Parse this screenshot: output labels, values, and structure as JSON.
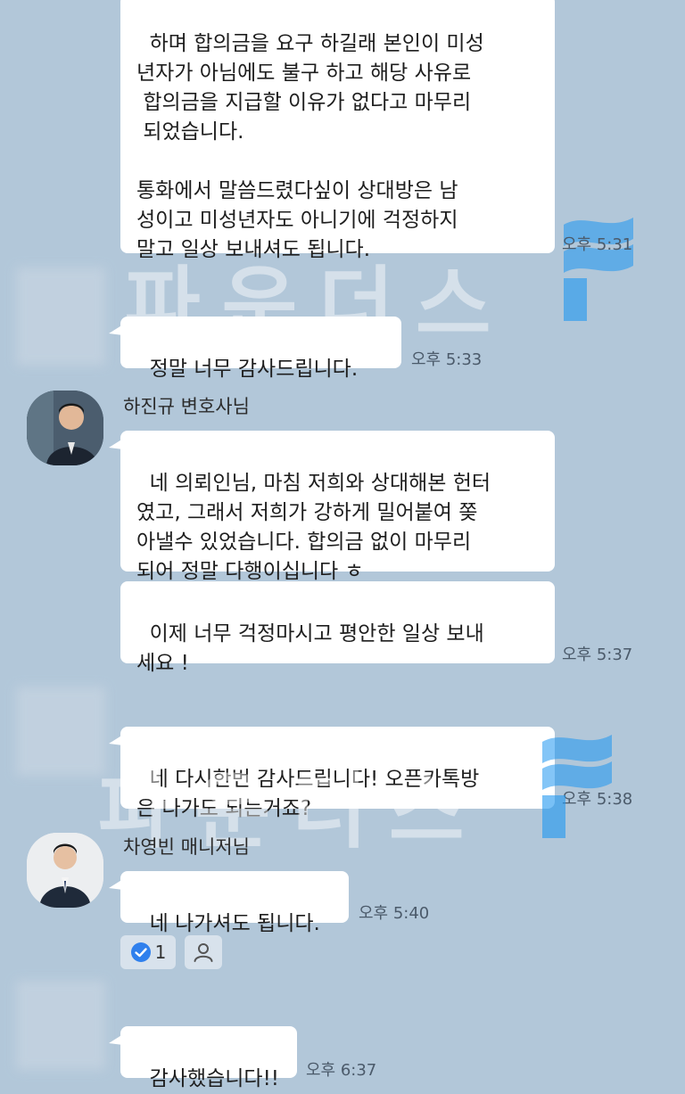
{
  "messages": {
    "msg1": {
      "text": "하며 합의금을 요구 하길래 본인이 미성\n년자가 아님에도 불구 하고 해당 사유로\n 합의금을 지급할 이유가 없다고 마무리\n 되었습니다.\n\n통화에서 말씀드렸다싶이 상대방은 남\n성이고 미성년자도 아니기에 걱정하지\n말고 일상 보내셔도 됩니다.",
      "time": "오후 5:31"
    },
    "msg2": {
      "text": "정말 너무 감사드립니다.",
      "time": "오후 5:33"
    },
    "sender1": "하진규 변호사님",
    "msg3": {
      "text": "네 의뢰인님, 마침 저희와 상대해본 헌터\n였고, 그래서 저희가 강하게 밀어붙여 쫒\n아낼수 있었습니다. 합의금 없이 마무리\n되어 정말 다행이십니다 ㅎ"
    },
    "msg4": {
      "text": "이제 너무 걱정마시고 평안한 일상 보내\n세요 !",
      "time": "오후 5:37"
    },
    "msg5": {
      "text": "네 다시한번 감사드립니다! 오픈카톡방\n은 나가도 되는거죠?",
      "time": "오후 5:38"
    },
    "sender2": "차영빈 매니저님",
    "msg6": {
      "text": "네 나가셔도 됩니다.",
      "time": "오후 5:40"
    },
    "reaction": {
      "count": "1",
      "icon": "check-circle-icon",
      "add_icon": "person-icon"
    },
    "msg7": {
      "text": "감사했습니다!!",
      "time": "오후 6:37"
    }
  },
  "watermark": {
    "text": "파운더스"
  },
  "colors": {
    "background": "#b2c7d9",
    "bubble": "#ffffff",
    "accent": "#2f80ed"
  }
}
